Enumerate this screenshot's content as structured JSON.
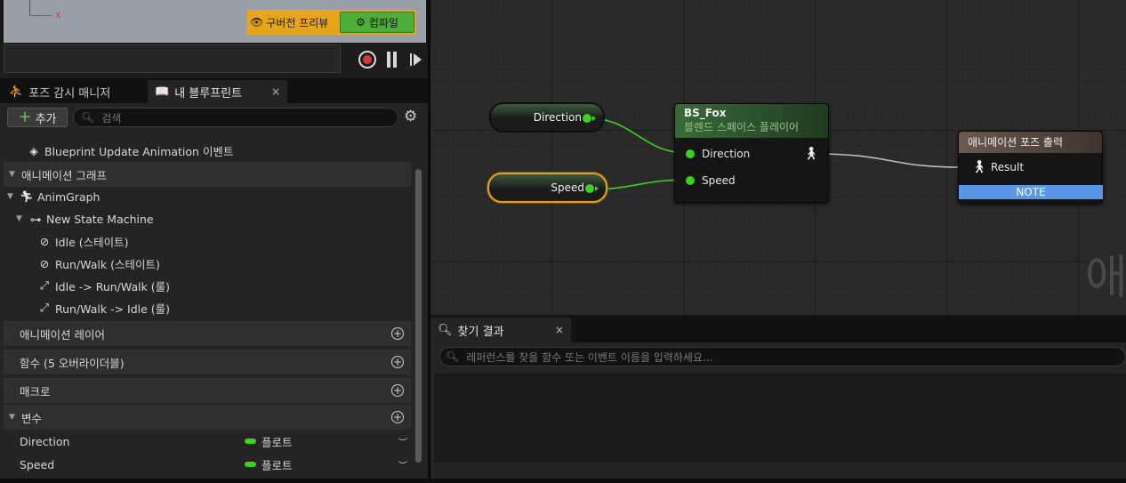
{
  "viewport": {
    "axis_label": "x"
  },
  "toolbar": {
    "legacy_preview_label": "구버전 프리뷰",
    "compile_label": "컴파일",
    "accent_color": "#e6a51a",
    "compile_color": "#4fae3a"
  },
  "debug": {
    "record_icon": "record-icon",
    "pause_icon": "pause-icon",
    "step_icon": "step-icon"
  },
  "tabs": {
    "pose_watch": "포즈 감시 매니저",
    "my_blueprint": "내 블루프린트",
    "close_glyph": "×"
  },
  "my_blueprint": {
    "add_label": "추가",
    "search_placeholder": "검색",
    "event_item": "Blueprint Update Animation 이벤트",
    "anim_graph_category": "애니메이션 그래프",
    "anim_graph": "AnimGraph",
    "state_machine": "New State Machine",
    "states": [
      "Idle (스테이트)",
      "Run/Walk (스테이트)"
    ],
    "rules": [
      "Idle -> Run/Walk (룰)",
      "Run/Walk -> Idle (룰)"
    ],
    "anim_layers": "애니메이션 레이어",
    "functions": "함수 (5 오버라이더블)",
    "macros": "매크로",
    "variables_category": "변수",
    "variables": [
      {
        "name": "Direction",
        "type": "플로트",
        "type_color": "#3fd11f"
      },
      {
        "name": "Speed",
        "type": "플로트",
        "type_color": "#3fd11f"
      }
    ]
  },
  "graph": {
    "var_nodes": [
      {
        "label": "Direction"
      },
      {
        "label": "Speed",
        "selected": true
      }
    ],
    "blendspace_node": {
      "title": "BS_Fox",
      "subtitle": "블렌드 스페이스 플레이어",
      "inputs": [
        "Direction",
        "Speed"
      ]
    },
    "output_node": {
      "title": "애니메이션 포즈 출력",
      "input": "Result",
      "note": "NOTE"
    },
    "watermark": "애"
  },
  "find": {
    "tab_label": "찾기 결과",
    "placeholder": "레퍼런스를 찾을 함수 또는 이벤트 이름을 입력하세요..."
  }
}
